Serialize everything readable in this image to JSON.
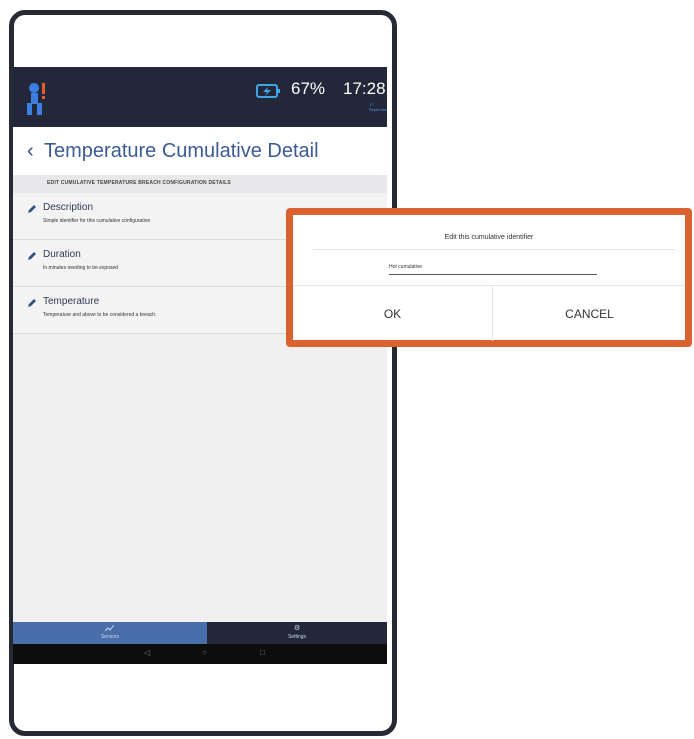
{
  "statusbar": {
    "battery": "67%",
    "time": "17:28",
    "date": "17 September"
  },
  "header": {
    "back_icon": "chevron-left",
    "title": "Temperature Cumulative Detail"
  },
  "section": {
    "title": "EDIT CUMULATIVE TEMPERATURE BREACH CONFIGURATION DETAILS"
  },
  "settings": [
    {
      "title": "Description",
      "desc": "Simple identifier for this cumulative configuration"
    },
    {
      "title": "Duration",
      "desc": "In minutes needing to be exposed"
    },
    {
      "title": "Temperature",
      "desc": "Temperature and above to be considered a breach."
    }
  ],
  "bottom_nav": {
    "tabs": [
      {
        "label": "Sensors",
        "icon": "chart-icon",
        "active": true
      },
      {
        "label": "Settings",
        "icon": "gear-icon",
        "active": false
      }
    ]
  },
  "dialog": {
    "title": "Edit this cumulative identifier",
    "input_value": "Hot cumulative",
    "ok_label": "OK",
    "cancel_label": "CANCEL"
  },
  "colors": {
    "status_bar": "#22283a",
    "title_blue": "#3c5b94",
    "active_tab": "#4a6ea9",
    "dialog_border": "#d9622f"
  }
}
